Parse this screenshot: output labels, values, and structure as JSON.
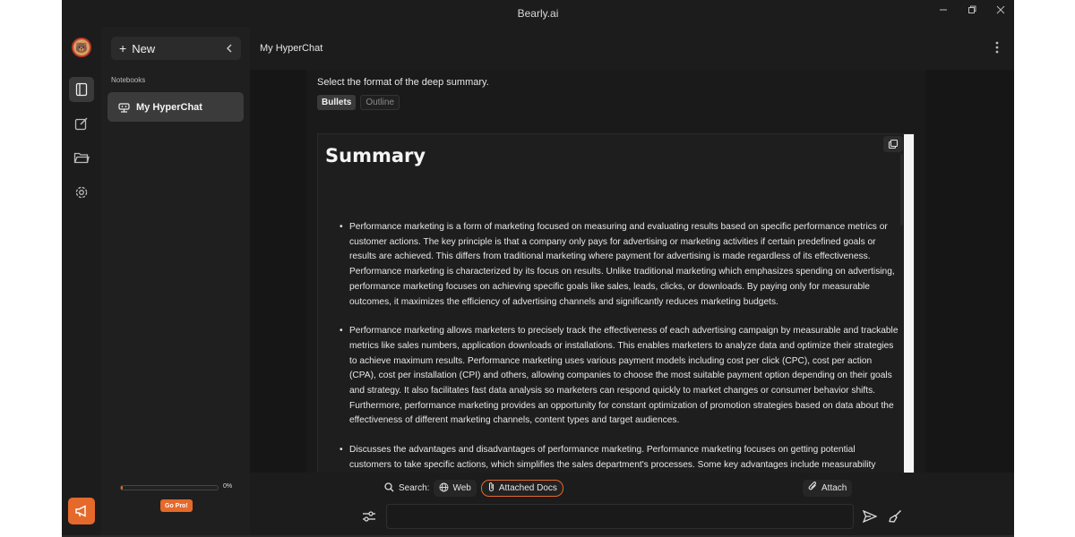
{
  "window": {
    "title": "Bearly.ai",
    "minimize_icon": "minimize-icon",
    "restore_icon": "restore-icon",
    "close_icon": "close-icon"
  },
  "rail": {
    "items": [
      "notebook-icon",
      "compose-icon",
      "folder-icon",
      "settings-icon"
    ],
    "promo_icon": "megaphone-icon"
  },
  "sidebar": {
    "new_label": "New",
    "section_label": "Notebooks",
    "notebooks": [
      {
        "label": "My HyperChat",
        "icon": "hyperchat-icon"
      }
    ],
    "usage_percent": "0%",
    "usage_fraction": 0.02,
    "go_pro_label": "Go Pro!"
  },
  "main": {
    "header_title": "My HyperChat",
    "format_prompt": "Select the format of the deep summary.",
    "format_options": [
      "Bullets",
      "Outline"
    ],
    "selected_format": "Bullets",
    "summary_title": "Summary",
    "bullets": [
      "Performance marketing is a form of marketing focused on measuring and evaluating results based on specific performance metrics or customer actions. The key principle is that a company only pays for advertising or marketing activities if certain predefined goals or results are achieved. This differs from traditional marketing where payment for advertising is made regardless of its effectiveness. Performance marketing is characterized by its focus on results. Unlike traditional marketing which emphasizes spending on advertising, performance marketing focuses on achieving specific goals like sales, leads, clicks, or downloads. By paying only for measurable outcomes, it maximizes the efficiency of advertising channels and significantly reduces marketing budgets.",
      "Performance marketing allows marketers to precisely track the effectiveness of each advertising campaign by measurable and trackable metrics like sales numbers, application downloads or installations. This enables marketers to analyze data and optimize their strategies to achieve maximum results. Performance marketing uses various payment models including cost per click (CPC), cost per action (CPA), cost per installation (CPI) and others, allowing companies to choose the most suitable payment option depending on their goals and strategy. It also facilitates fast data analysis so marketers can respond quickly to market changes or consumer behavior shifts. Furthermore, performance marketing provides an opportunity for constant optimization of promotion strategies based on data about the effectiveness of different marketing channels, content types and target audiences.",
      "Discusses the advantages and disadvantages of performance marketing. Performance marketing focuses on getting potential customers to take specific actions, which simplifies the sales department's processes. Some key advantages include measurability"
    ]
  },
  "bottom": {
    "search_label": "Search:",
    "web_label": "Web",
    "docs_label": "Attached Docs",
    "attach_label": "Attach",
    "message_placeholder": ""
  },
  "colors": {
    "accent": "#e4692b",
    "background": "#1c1c1c"
  }
}
